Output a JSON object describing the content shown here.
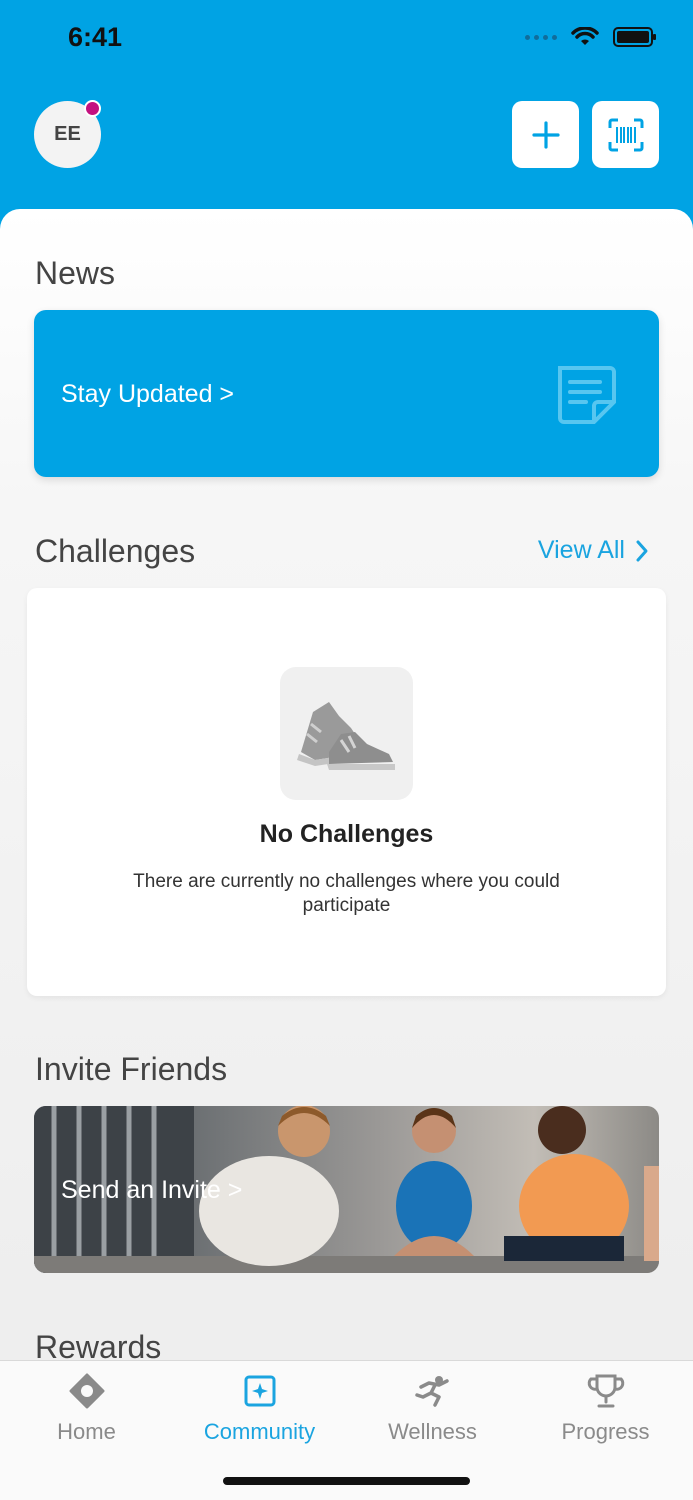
{
  "status_bar": {
    "time": "6:41"
  },
  "header": {
    "avatar_initials": "EE",
    "add_icon": "plus-icon",
    "scan_icon": "barcode-scan-icon",
    "accent_color": "#00a3e4",
    "notification_color": "#c4117f"
  },
  "news": {
    "title": "News",
    "card_label": "Stay Updated >",
    "icon": "document-icon"
  },
  "challenges": {
    "title": "Challenges",
    "view_all": "View All",
    "empty_title": "No Challenges",
    "empty_body": "There are currently no challenges where you could participate",
    "empty_icon": "sneakers-icon"
  },
  "invite": {
    "title": "Invite Friends",
    "card_label": "Send an Invite >"
  },
  "rewards": {
    "title": "Rewards"
  },
  "tabs": [
    {
      "label": "Home",
      "icon": "diamond-icon",
      "active": false
    },
    {
      "label": "Community",
      "icon": "community-icon",
      "active": true
    },
    {
      "label": "Wellness",
      "icon": "runner-icon",
      "active": false
    },
    {
      "label": "Progress",
      "icon": "trophy-icon",
      "active": false
    }
  ]
}
